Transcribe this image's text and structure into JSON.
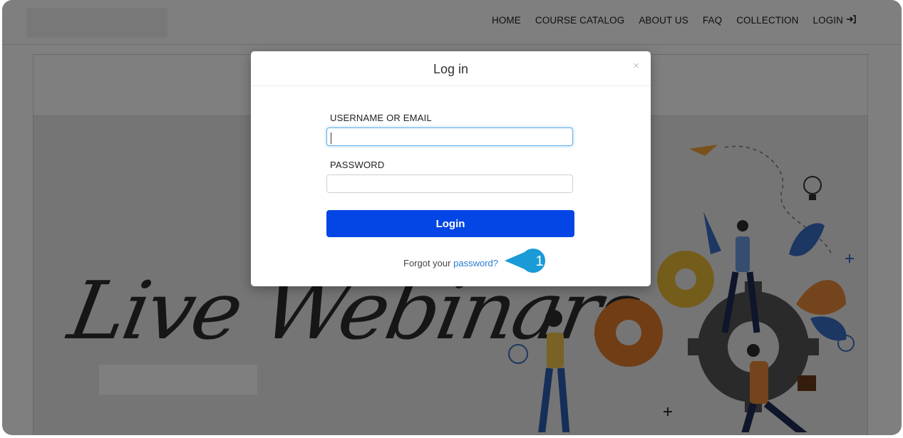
{
  "nav": {
    "items": [
      "HOME",
      "COURSE CATALOG",
      "ABOUT US",
      "FAQ",
      "COLLECTION"
    ],
    "login_label": "LOGIN",
    "login_icon": "sign-in-icon"
  },
  "hero": {
    "title": "Live Webinars"
  },
  "modal": {
    "title": "Log in",
    "close_label": "×",
    "username_label": "USERNAME OR EMAIL",
    "username_value": "",
    "password_label": "PASSWORD",
    "password_value": "",
    "login_button": "Login",
    "forgot_prefix": "Forgot your",
    "forgot_link": "password?"
  },
  "callout": {
    "number": "1",
    "color": "#1a9ad6"
  },
  "colors": {
    "primary_button": "#0346e5",
    "link": "#2a7bd4",
    "overlay": "rgba(0,0,0,0.5)"
  }
}
